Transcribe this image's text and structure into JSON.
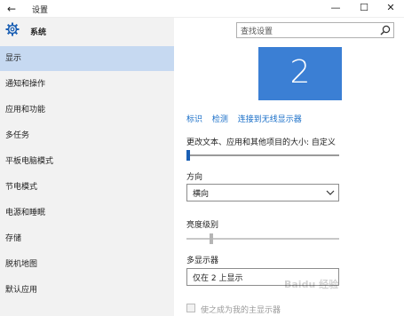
{
  "window": {
    "title": "设置",
    "minimize": "—",
    "maximize": "☐",
    "close": "✕"
  },
  "sidebar": {
    "brand": "系统",
    "items": [
      {
        "label": "显示",
        "active": true
      },
      {
        "label": "通知和操作"
      },
      {
        "label": "应用和功能"
      },
      {
        "label": "多任务"
      },
      {
        "label": "平板电脑模式"
      },
      {
        "label": "节电模式"
      },
      {
        "label": "电源和睡眠"
      },
      {
        "label": "存储"
      },
      {
        "label": "脱机地图"
      },
      {
        "label": "默认应用"
      }
    ]
  },
  "search": {
    "placeholder": "查找设置"
  },
  "display": {
    "monitor_number": "2",
    "links": [
      "标识",
      "检测",
      "连接到无线显示器"
    ],
    "scale_label": "更改文本、应用和其他项目的大小: 自定义",
    "orientation_label": "方向",
    "orientation_value": "横向",
    "brightness_label": "亮度级别",
    "multi_display_label": "多显示器",
    "multi_display_value": "仅在 2 上显示",
    "make_main_label": "使之成为我的主显示器"
  },
  "watermark": "Baidu 经验",
  "colors": {
    "accent": "#3b7fd4",
    "selected_nav": "#c6d9f1",
    "link": "#1a6fc8"
  }
}
